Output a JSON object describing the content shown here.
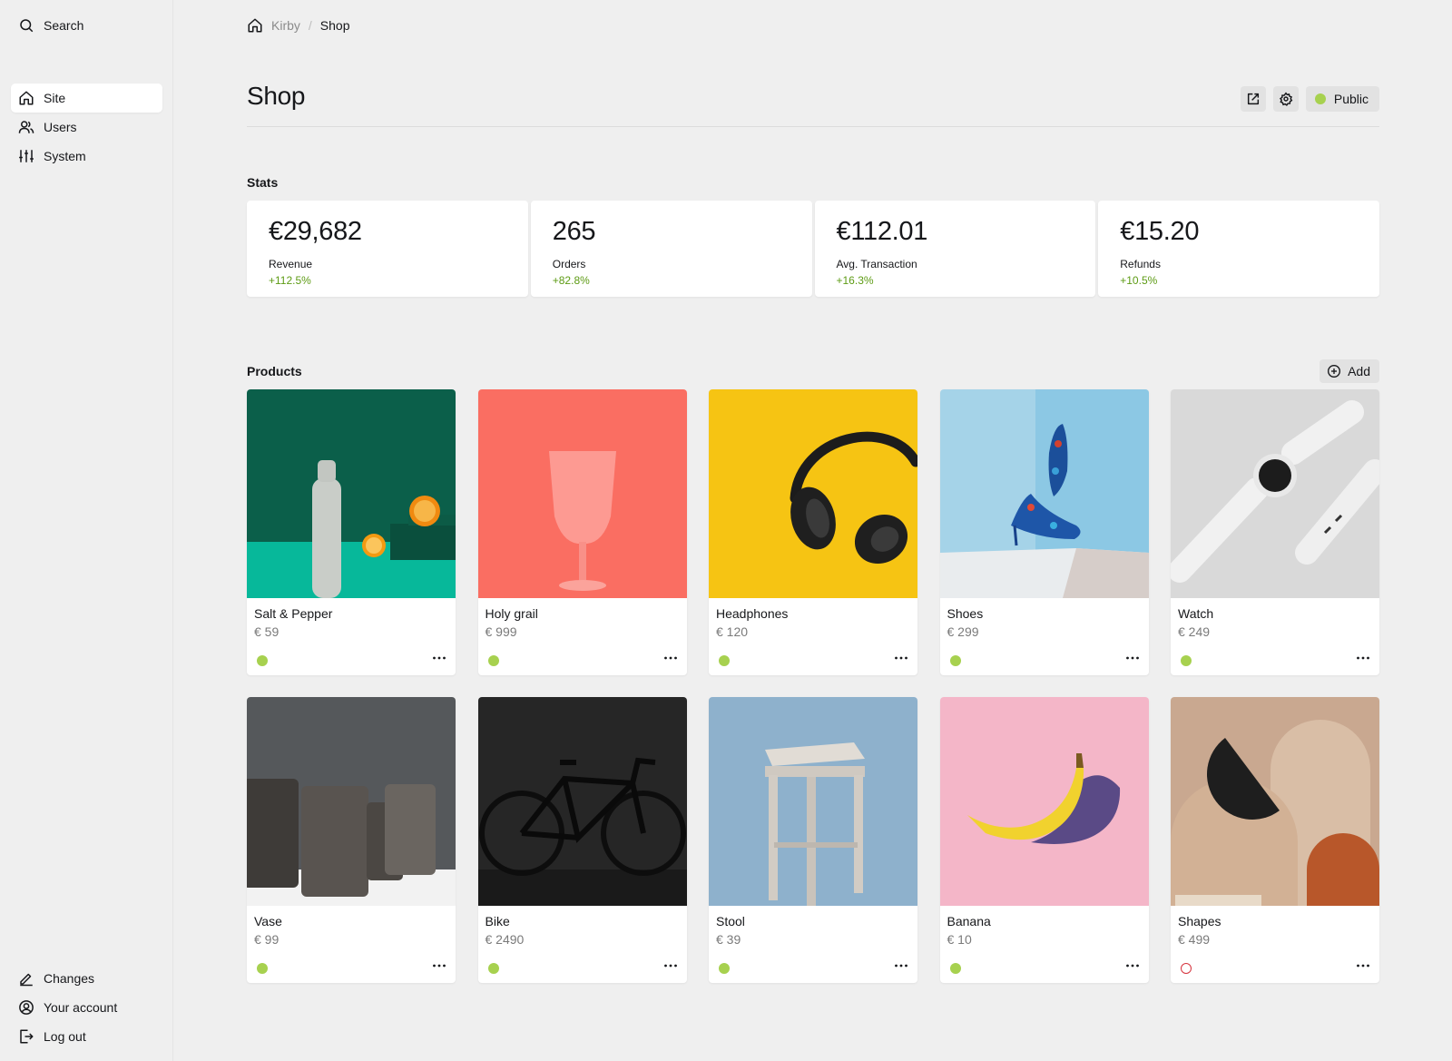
{
  "sidebar": {
    "search_label": "Search",
    "menu": [
      {
        "label": "Site",
        "icon": "home-icon",
        "active": true
      },
      {
        "label": "Users",
        "icon": "users-icon"
      },
      {
        "label": "System",
        "icon": "sliders-icon"
      }
    ],
    "footer": [
      {
        "label": "Changes",
        "icon": "edit-icon"
      },
      {
        "label": "Your account",
        "icon": "account-icon"
      },
      {
        "label": "Log out",
        "icon": "logout-icon"
      }
    ]
  },
  "breadcrumb": {
    "root": "Kirby",
    "separator": "/",
    "current": "Shop"
  },
  "page": {
    "title": "Shop",
    "status_label": "Public",
    "status_color": "#a7d14f"
  },
  "stats": {
    "label": "Stats",
    "items": [
      {
        "value": "€29,682",
        "label": "Revenue",
        "info": "+112.5%"
      },
      {
        "value": "265",
        "label": "Orders",
        "info": "+82.8%"
      },
      {
        "value": "€112.01",
        "label": "Avg. Transaction",
        "info": "+16.3%"
      },
      {
        "value": "€15.20",
        "label": "Refunds",
        "info": "+10.5%"
      }
    ]
  },
  "products": {
    "label": "Products",
    "add_label": "Add",
    "items": [
      {
        "title": "Salt & Pepper",
        "price": "€ 59",
        "status": "listed"
      },
      {
        "title": "Holy grail",
        "price": "€ 999",
        "status": "listed"
      },
      {
        "title": "Headphones",
        "price": "€ 120",
        "status": "listed"
      },
      {
        "title": "Shoes",
        "price": "€ 299",
        "status": "listed"
      },
      {
        "title": "Watch",
        "price": "€ 249",
        "status": "listed"
      },
      {
        "title": "Vase",
        "price": "€ 99",
        "status": "listed"
      },
      {
        "title": "Bike",
        "price": "€ 2490",
        "status": "listed"
      },
      {
        "title": "Stool",
        "price": "€ 39",
        "status": "listed"
      },
      {
        "title": "Banana",
        "price": "€ 10",
        "status": "listed"
      },
      {
        "title": "Shapes",
        "price": "€ 499",
        "status": "draft"
      }
    ]
  },
  "colors": {
    "accent_green": "#a7d14f",
    "info_green": "#5d9b14",
    "draft_red": "#d6343e",
    "background": "#efefef"
  }
}
